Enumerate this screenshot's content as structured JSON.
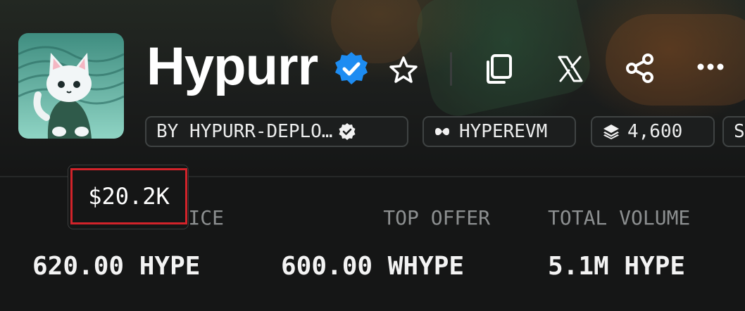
{
  "collection": {
    "name": "Hypurr",
    "verified": true,
    "creator": "BY HYPURR-DEPLO…",
    "chain": "HYPEREVM",
    "item_count": "4,600",
    "extra_chip": "S"
  },
  "actions": {
    "icons": [
      "star-icon",
      "copy-icon",
      "x-logo-icon",
      "share-icon",
      "more-icon"
    ]
  },
  "stats": {
    "floor_label": "ICE",
    "floor_value": "620.00 HYPE",
    "top_offer_label": "TOP OFFER",
    "top_offer_value": "600.00 WHYPE",
    "volume_label": "TOTAL VOLUME",
    "volume_value": "5.1M HYPE"
  },
  "tooltip": {
    "value": "$20.2K"
  },
  "colors": {
    "background": "#151616",
    "verified_blue": "#1d8cf2",
    "highlight_red": "#d2232a",
    "label_gray": "#8c8f90"
  }
}
